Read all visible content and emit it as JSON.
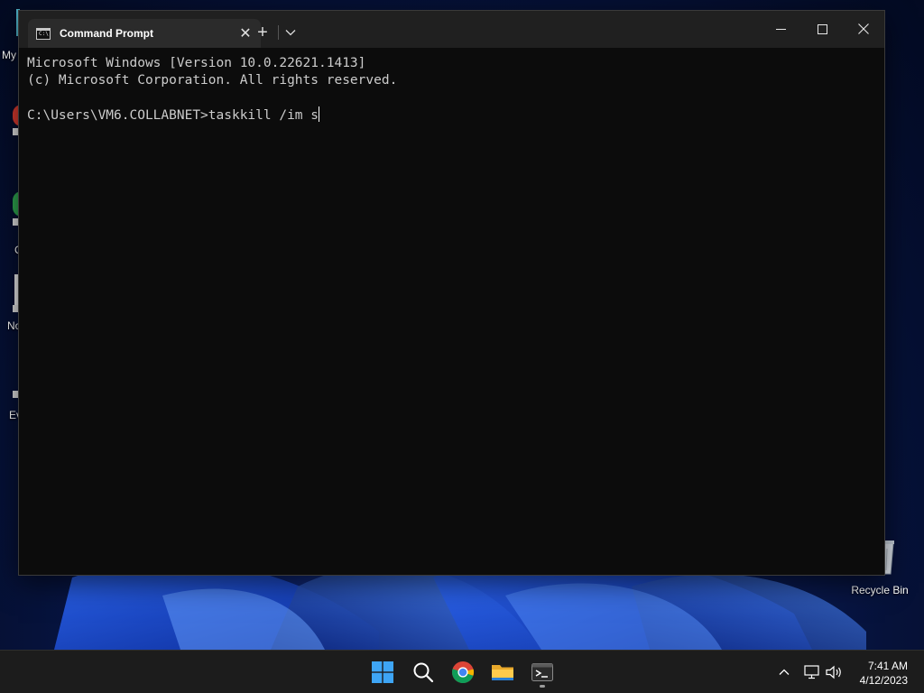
{
  "desktop": {
    "icons": [
      {
        "label": "Recycle Bin"
      }
    ],
    "partial_labels": [
      "My",
      "C",
      "No",
      "Ev"
    ]
  },
  "window": {
    "tab_title": "Command Prompt",
    "tab_icon_text": "C:\\",
    "new_tab_symbol": "+",
    "close_tab_symbol": "✕",
    "console_lines": [
      "Microsoft Windows [Version 10.0.22621.1413]",
      "(c) Microsoft Corporation. All rights reserved.",
      "",
      "C:\\Users\\VM6.COLLABNET>taskkill /im s"
    ]
  },
  "taskbar": {
    "apps": [
      {
        "name": "start",
        "icon": "windows-logo-icon"
      },
      {
        "name": "search",
        "icon": "search-icon"
      },
      {
        "name": "chrome",
        "icon": "chrome-icon"
      },
      {
        "name": "file-explorer",
        "icon": "folder-icon"
      },
      {
        "name": "terminal",
        "icon": "terminal-icon",
        "active": true
      }
    ],
    "clock": {
      "time": "7:41 AM",
      "date": "4/12/2023"
    }
  },
  "colors": {
    "console_bg": "#0c0c0c",
    "console_text": "#cccccc",
    "titlebar_bg": "#202020",
    "taskbar_bg": "#1c1c1c"
  }
}
